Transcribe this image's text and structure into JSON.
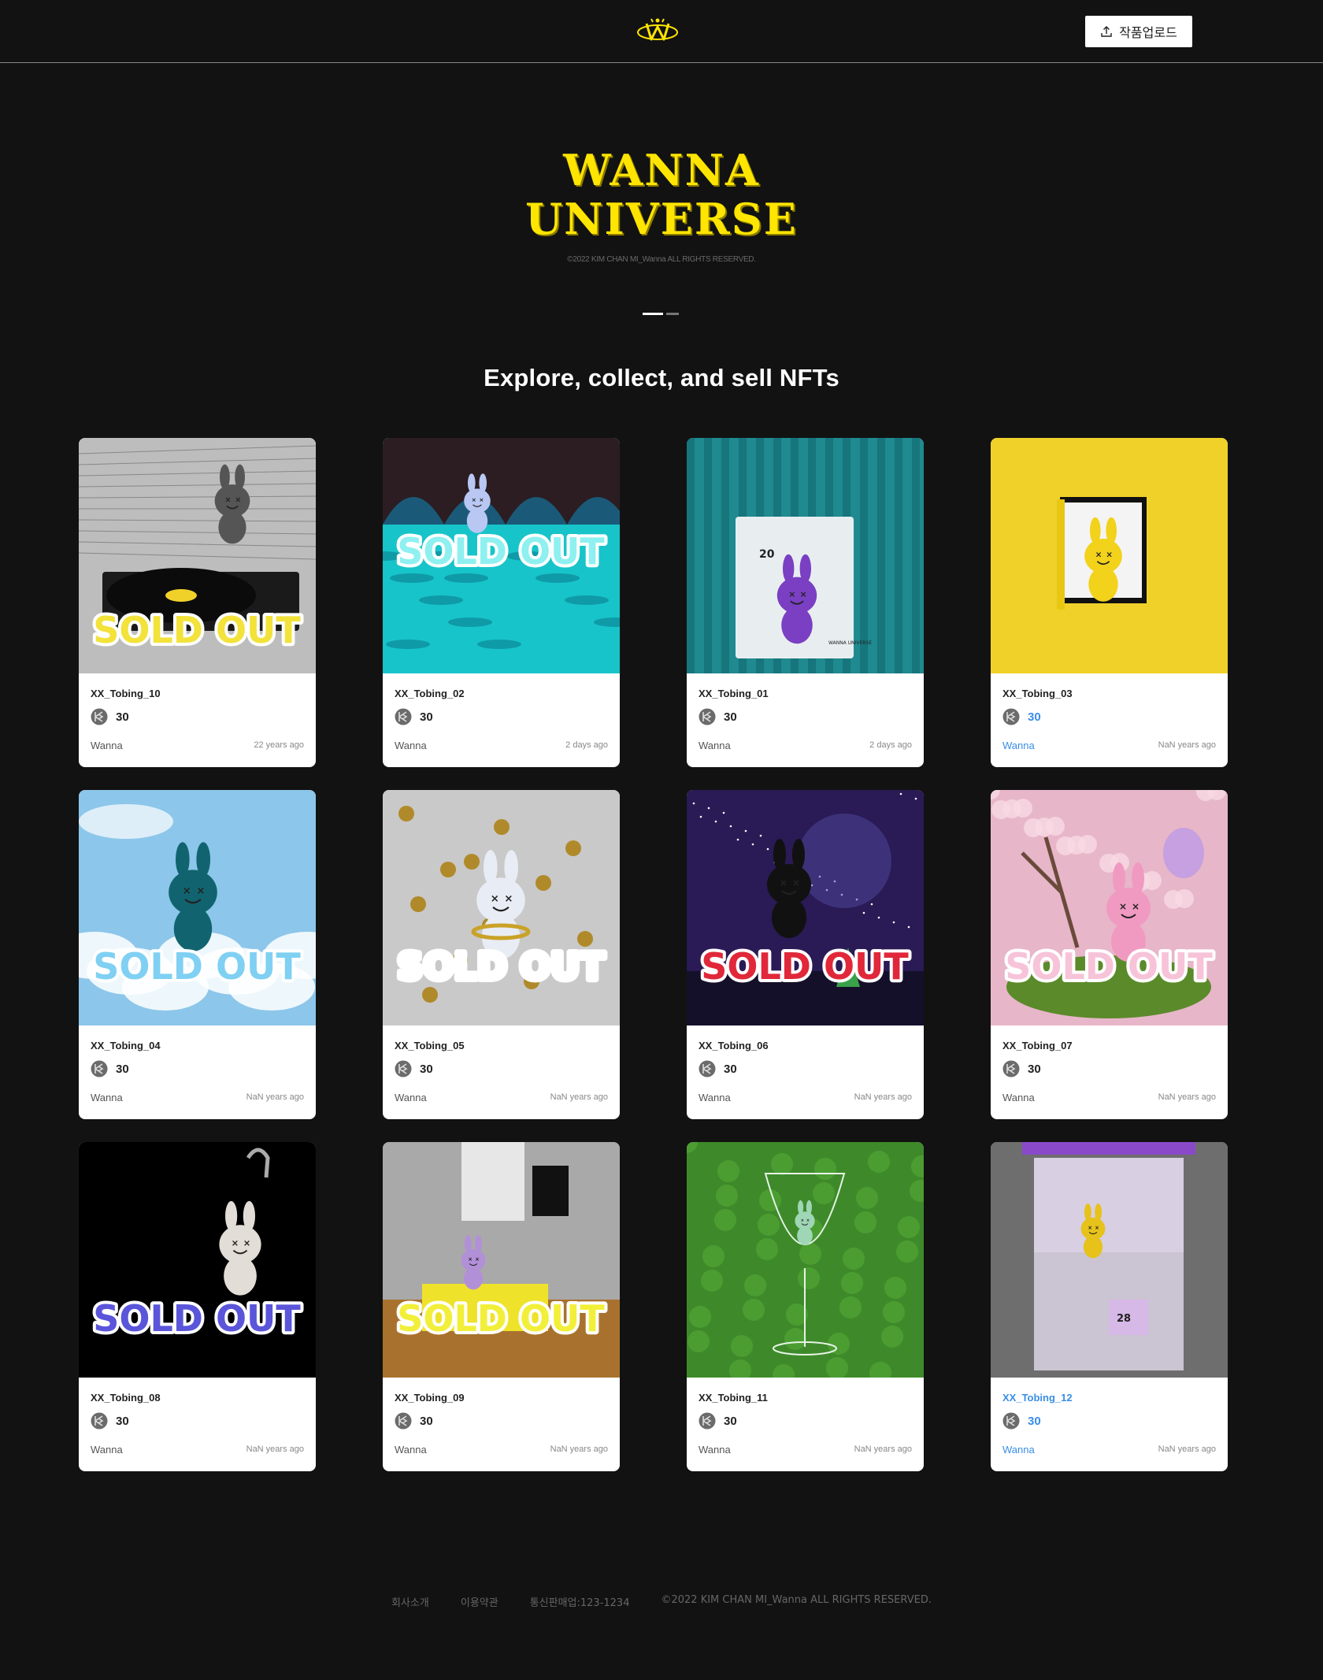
{
  "header": {
    "upload_label": "작품업로드"
  },
  "hero": {
    "title_line1": "WANNA",
    "title_line2": "UNIVERSE",
    "copyright": "©2022 KIM CHAN MI_Wanna ALL RIGHTS RESERVED.",
    "slides": 2,
    "active_slide": 1
  },
  "section": {
    "title": "Explore, collect, and sell NFTs"
  },
  "sold_out_text": "SOLD OUT",
  "cards": [
    {
      "name": "XX_Tobing_10",
      "price": "30",
      "owner": "Wanna",
      "time": "22 years ago",
      "sold_out": true,
      "theme": "record",
      "bg": "#bdbdbd",
      "sold_color": "#f2e23a"
    },
    {
      "name": "XX_Tobing_02",
      "price": "30",
      "owner": "Wanna",
      "time": "2 days ago",
      "sold_out": true,
      "theme": "water",
      "bg": "#17c4c9",
      "sold_color": "#8ff0f0"
    },
    {
      "name": "XX_Tobing_01",
      "price": "30",
      "owner": "Wanna",
      "time": "2 days ago",
      "sold_out": false,
      "theme": "box",
      "bg": "#1f8a8f",
      "box_number": "20",
      "box_text": "WANNA UNIVERSE"
    },
    {
      "name": "XX_Tobing_03",
      "price": "30",
      "owner": "Wanna",
      "time": "NaN years ago",
      "sold_out": false,
      "theme": "yellow",
      "bg": "#f0d12a",
      "highlight": true
    },
    {
      "name": "XX_Tobing_04",
      "price": "30",
      "owner": "Wanna",
      "time": "NaN years ago",
      "sold_out": true,
      "theme": "sky",
      "bg": "#8cc6ea",
      "sold_color": "#7fd0f3"
    },
    {
      "name": "XX_Tobing_05",
      "price": "30",
      "owner": "Wanna",
      "time": "NaN years ago",
      "sold_out": true,
      "theme": "silver",
      "bg": "#c9c9c9",
      "sold_color": "#ffffff"
    },
    {
      "name": "XX_Tobing_06",
      "price": "30",
      "owner": "Wanna",
      "time": "NaN years ago",
      "sold_out": true,
      "theme": "night",
      "bg": "#2a1a55",
      "sold_color": "#e0283a"
    },
    {
      "name": "XX_Tobing_07",
      "price": "30",
      "owner": "Wanna",
      "time": "NaN years ago",
      "sold_out": true,
      "theme": "blossom",
      "bg": "#e7b6c9",
      "sold_color": "#f7c3d8"
    },
    {
      "name": "XX_Tobing_08",
      "price": "30",
      "owner": "Wanna",
      "time": "NaN years ago",
      "sold_out": true,
      "theme": "black",
      "bg": "#000000",
      "sold_color": "#5a55d9"
    },
    {
      "name": "XX_Tobing_09",
      "price": "30",
      "owner": "Wanna",
      "time": "NaN years ago",
      "sold_out": true,
      "theme": "room",
      "bg": "#a9a9a9",
      "sold_color": "#f2ef3a"
    },
    {
      "name": "XX_Tobing_11",
      "price": "30",
      "owner": "Wanna",
      "time": "NaN years ago",
      "sold_out": false,
      "theme": "glass",
      "bg": "#3e8a2a"
    },
    {
      "name": "XX_Tobing_12",
      "price": "30",
      "owner": "Wanna",
      "time": "NaN years ago",
      "sold_out": false,
      "theme": "claw",
      "bg": "#6e6e6e",
      "highlight_name": true,
      "machine_number": "28"
    }
  ],
  "footer": {
    "links": [
      "회사소개",
      "이용약관",
      "통신판매업:123-1234"
    ],
    "copyright": "©2022 KIM CHAN MI_Wanna ALL RIGHTS RESERVED."
  },
  "colors": {
    "background": "#121212",
    "accent_yellow": "#ffe500",
    "link_blue": "#3a8ee6"
  }
}
